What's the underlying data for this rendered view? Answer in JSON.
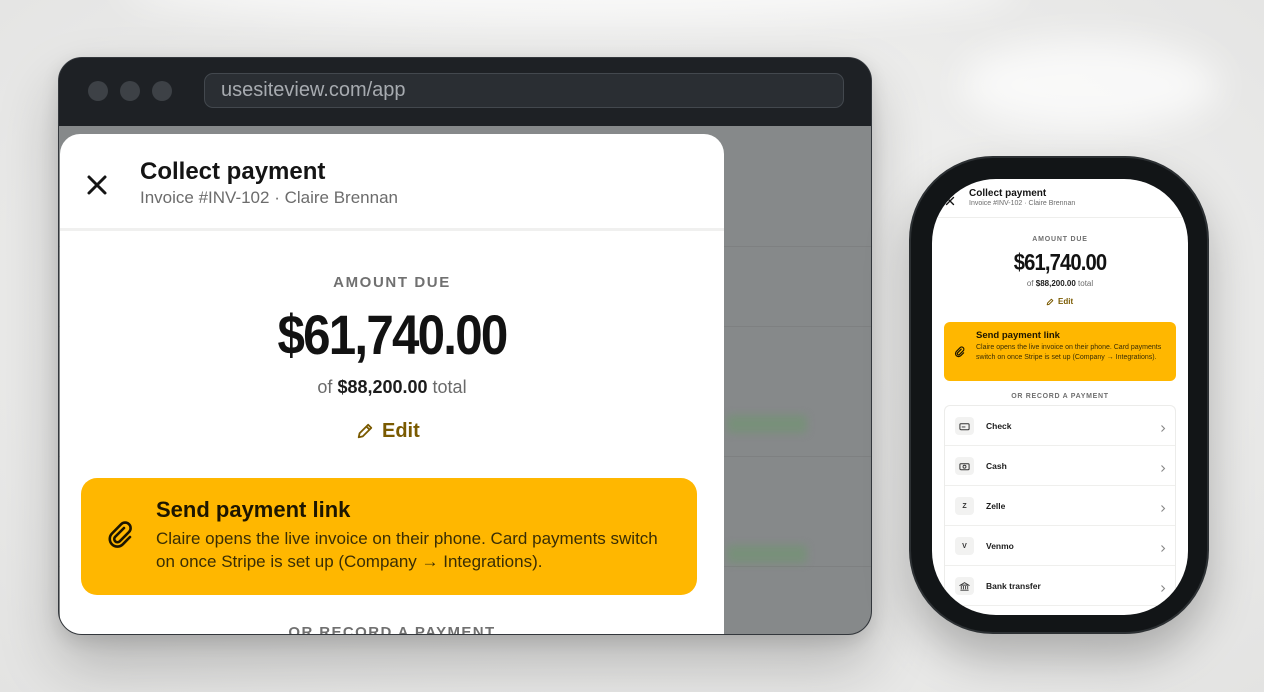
{
  "browser": {
    "url": "usesiteview.com/app"
  },
  "sheet": {
    "title": "Collect payment",
    "subtitle": "Invoice #INV-102 · Claire Brennan",
    "amount_label": "AMOUNT DUE",
    "amount_due": "$61,740.00",
    "total_prefix": "of",
    "total_amount": "$88,200.00",
    "total_suffix": "total",
    "edit_label": "Edit",
    "payment_link": {
      "title": "Send payment link",
      "description": "Claire opens the live invoice on their phone. Card payments switch on once Stripe is set up (Company → Integrations)."
    },
    "or_label": "OR RECORD A PAYMENT"
  },
  "methods": [
    {
      "label": "Check",
      "icon": "check-icon"
    },
    {
      "label": "Cash",
      "icon": "cash-icon"
    },
    {
      "label": "Zelle",
      "icon": "zelle-icon",
      "glyph": "Z"
    },
    {
      "label": "Venmo",
      "icon": "venmo-icon",
      "glyph": "V"
    },
    {
      "label": "Bank transfer",
      "icon": "bank-icon"
    }
  ],
  "colors": {
    "accent": "#ffb700",
    "edit": "#7a5a00",
    "window": "#1b1e22"
  }
}
